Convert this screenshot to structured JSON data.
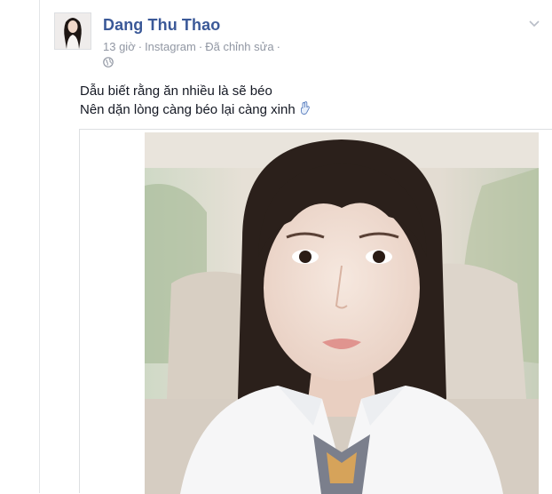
{
  "post": {
    "author": "Dang Thu Thao",
    "time": "13 giờ",
    "separator": "·",
    "source": "Instagram",
    "edited": "Đã chỉnh sửa",
    "privacy_icon": "globe-icon",
    "menu_icon": "chevron-down-icon",
    "lines": [
      "Dẫu biết rằng ăn nhiều là sẽ béo",
      "Nên dặn lòng càng béo lại càng xinh"
    ],
    "line_emoji": "hand-gesture-icon"
  },
  "colors": {
    "author_link": "#3b5998",
    "meta_text": "#9197a3",
    "body_text": "#141823",
    "border": "#dddfe2"
  }
}
